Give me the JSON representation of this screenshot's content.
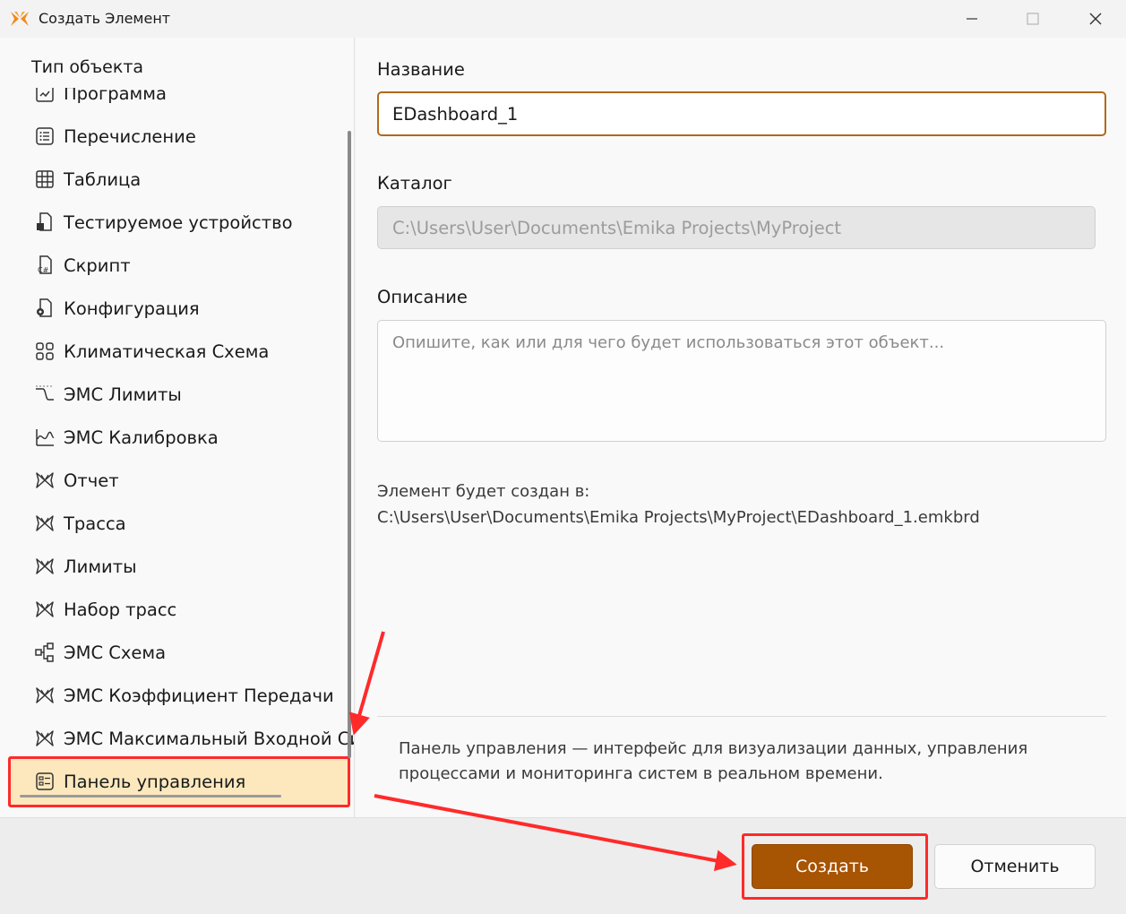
{
  "window": {
    "title": "Создать Элемент",
    "controls": [
      "minimize",
      "maximize",
      "close"
    ]
  },
  "left_panel": {
    "header": "Тип объекта",
    "items": [
      {
        "label": "Программа",
        "icon": "program-icon"
      },
      {
        "label": "Перечисление",
        "icon": "list-icon"
      },
      {
        "label": "Таблица",
        "icon": "table-icon"
      },
      {
        "label": "Тестируемое устройство",
        "icon": "device-icon"
      },
      {
        "label": "Скрипт",
        "icon": "csharp-script-icon"
      },
      {
        "label": "Конфигурация",
        "icon": "config-icon"
      },
      {
        "label": "Климатическая Схема",
        "icon": "climate-scheme-icon"
      },
      {
        "label": "ЭМС Лимиты",
        "icon": "emc-limits-icon"
      },
      {
        "label": "ЭМС Калибровка",
        "icon": "emc-calibration-icon"
      },
      {
        "label": "Отчет",
        "icon": "butterfly-icon"
      },
      {
        "label": "Трасса",
        "icon": "butterfly-icon"
      },
      {
        "label": "Лимиты",
        "icon": "butterfly-icon"
      },
      {
        "label": "Набор трасс",
        "icon": "butterfly-icon"
      },
      {
        "label": "ЭМС Схема",
        "icon": "emc-scheme-icon"
      },
      {
        "label": "ЭМС Коэффициент Передачи",
        "icon": "butterfly-icon"
      },
      {
        "label": "ЭМС Максимальный Входной Си",
        "icon": "butterfly-icon"
      },
      {
        "label": "Панель управления",
        "icon": "dashboard-icon"
      }
    ],
    "selected_index": 16
  },
  "form": {
    "name_label": "Название",
    "name_value": "EDashboard_1",
    "catalog_label": "Каталог",
    "catalog_value": "C:\\Users\\User\\Documents\\Emika Projects\\MyProject",
    "description_label": "Описание",
    "description_placeholder": "Опишите, как или для чего будет использоваться этот объект...",
    "path_caption": "Элемент будет создан в:",
    "path_value": "C:\\Users\\User\\Documents\\Emika Projects\\MyProject\\EDashboard_1.emkbrd",
    "info_text": "Панель управления — интерфейс для визуализации данных, управления процессами и мониторинга систем в реальном времени."
  },
  "buttons": {
    "create": "Создать",
    "cancel": "Отменить"
  },
  "colors": {
    "accent": "#a75403",
    "input_border": "#b06a1a",
    "annotation": "#ff2a2a",
    "selected_bg": "#fde8be"
  }
}
